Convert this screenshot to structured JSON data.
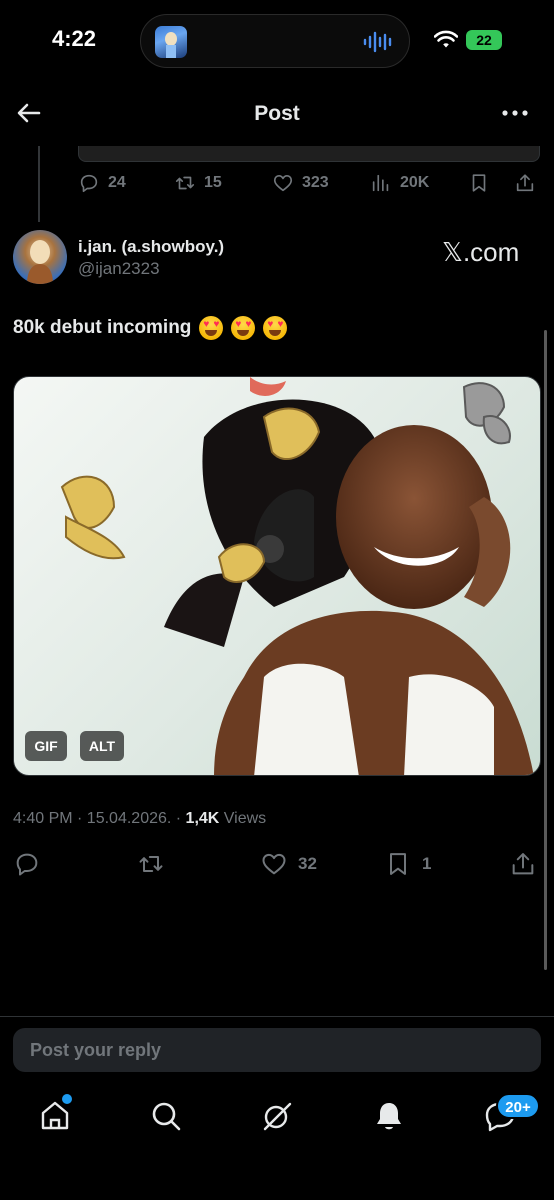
{
  "status_bar": {
    "time": "4:22",
    "battery": "22"
  },
  "header": {
    "title": "Post"
  },
  "previous_tweet": {
    "replies": "24",
    "reposts": "15",
    "likes": "323",
    "views": "20K"
  },
  "post": {
    "author_name": "i.jan. (a.showboy.)",
    "author_handle": "@ijan2323",
    "source_label": "𝕏.com",
    "text": "80k debut incoming",
    "emoji_count": 3,
    "media_badges": {
      "gif": "GIF",
      "alt": "ALT"
    },
    "timestamp": "4:40 PM · 15.04.2026. · ",
    "views_count": "1,4K",
    "views_label": " Views",
    "likes": "32",
    "bookmarks": "1"
  },
  "reply": {
    "placeholder": "Post your reply"
  },
  "tab_bar": {
    "items": [
      "home-icon",
      "search-icon",
      "grok-icon",
      "notifications-icon",
      "messages-icon"
    ],
    "messages_badge": "20+"
  },
  "colors": {
    "background": "#000000",
    "text_primary": "#e7e9ea",
    "text_secondary": "#71767b",
    "accent": "#1d9bf0"
  }
}
